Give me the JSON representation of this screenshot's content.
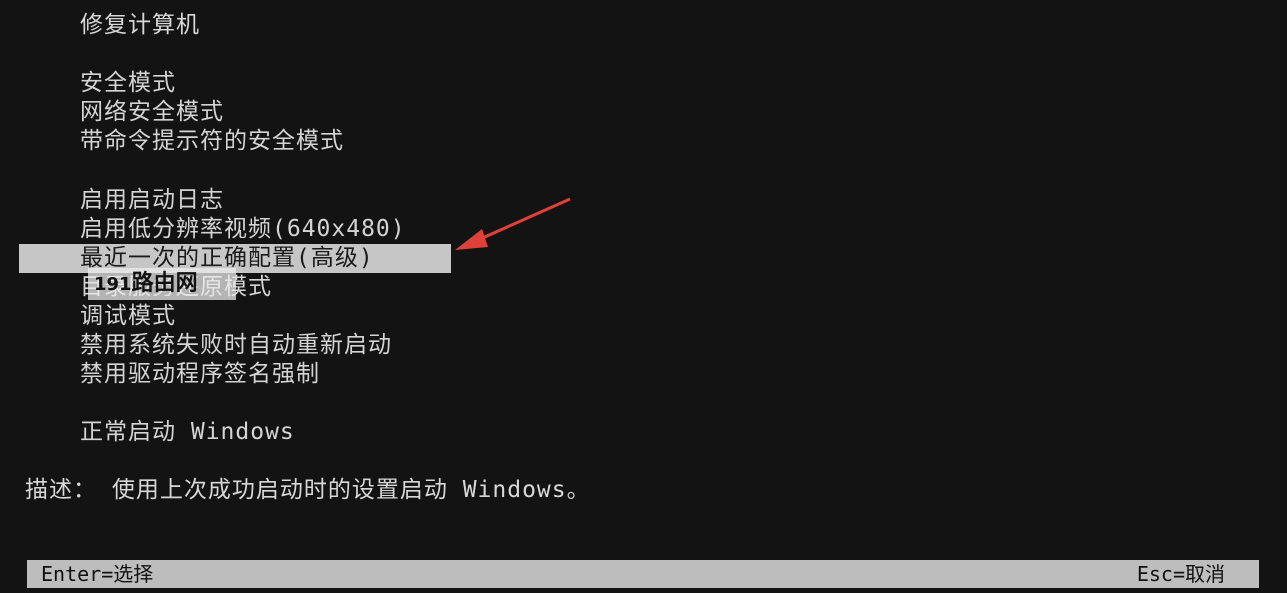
{
  "header": {
    "title": "修复计算机"
  },
  "menu": {
    "items": [
      {
        "label": "安全模式"
      },
      {
        "label": "网络安全模式"
      },
      {
        "label": "带命令提示符的安全模式"
      },
      {
        "label": "启用启动日志"
      },
      {
        "label": "启用低分辨率视频(640x480)"
      },
      {
        "label": "最近一次的正确配置(高级)",
        "selected": true
      },
      {
        "label": "目录服务还原模式"
      },
      {
        "label": "调试模式"
      },
      {
        "label": "禁用系统失败时自动重新启动"
      },
      {
        "label": "禁用驱动程序签名强制"
      },
      {
        "label": "正常启动 Windows"
      }
    ]
  },
  "description": {
    "text": "描述： 使用上次成功启动时的设置启动 Windows。"
  },
  "footer": {
    "left": "Enter=选择",
    "right": "Esc=取消"
  },
  "watermark": {
    "number": "191",
    "text": "路由网"
  },
  "colors": {
    "background": "#131313",
    "text": "#d4d4d4",
    "highlight": "#c6c6c6",
    "arrow": "#e0403a"
  },
  "icons": {
    "annotation": "red-arrow-icon"
  }
}
